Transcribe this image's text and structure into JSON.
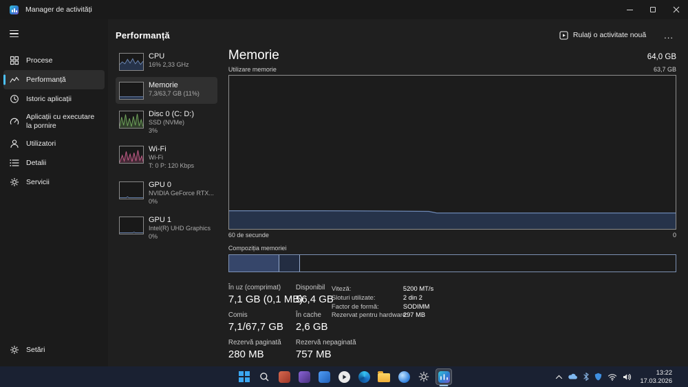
{
  "window": {
    "title": "Manager de activități"
  },
  "sidebar": {
    "items": [
      {
        "label": "Procese"
      },
      {
        "label": "Performanță"
      },
      {
        "label": "Istoric aplicații"
      },
      {
        "label": "Aplicații cu executare la pornire"
      },
      {
        "label": "Utilizatori"
      },
      {
        "label": "Detalii"
      },
      {
        "label": "Servicii"
      }
    ],
    "settings_label": "Setări"
  },
  "header": {
    "title": "Performanță",
    "run_new_task": "Rulați o activitate nouă",
    "more": "..."
  },
  "perf_list": [
    {
      "name": "CPU",
      "line1": "16% 2,33 GHz",
      "line2": ""
    },
    {
      "name": "Memorie",
      "line1": "7,3/63,7 GB (11%)",
      "line2": ""
    },
    {
      "name": "Disc 0 (C: D:)",
      "line1": "SSD (NVMe)",
      "line2": "3%"
    },
    {
      "name": "Wi-Fi",
      "line1": "Wi-Fi",
      "line2": "T: 0 P: 120 Kbps"
    },
    {
      "name": "GPU 0",
      "line1": "NVIDIA GeForce RTX...",
      "line2": "0%"
    },
    {
      "name": "GPU 1",
      "line1": "Intel(R) UHD Graphics",
      "line2": "0%"
    }
  ],
  "memory": {
    "title": "Memorie",
    "capacity": "64,0 GB",
    "chart_title": "Utilizare memorie",
    "chart_max": "63,7 GB",
    "x_left": "60 de secunde",
    "x_right": "0",
    "composition_title": "Compoziția memoriei",
    "usage_percent": 11,
    "usage_history_percent": [
      12,
      12,
      12,
      12,
      12,
      12,
      11,
      11,
      11,
      11,
      11,
      11
    ],
    "stats": [
      {
        "label": "În uz (comprimat)",
        "value": "7,1 GB (0,1 MB)"
      },
      {
        "label": "Disponibil",
        "value": "56,4 GB"
      },
      {
        "label": "Comis",
        "value": "7,1/67,7 GB"
      },
      {
        "label": "În cache",
        "value": "2,6 GB"
      },
      {
        "label": "Rezervă paginată",
        "value": "280 MB"
      },
      {
        "label": "Rezervă nepaginată",
        "value": "757 MB"
      }
    ],
    "details": [
      {
        "label": "Viteză:",
        "value": "5200 MT/s"
      },
      {
        "label": "Sloturi utilizate:",
        "value": "2 din 2"
      },
      {
        "label": "Factor de formă:",
        "value": "SODIMM"
      },
      {
        "label": "Rezervat pentru hardware:",
        "value": "297 MB"
      }
    ]
  },
  "taskbar": {
    "time": "13:22",
    "date": "17.03.2026"
  },
  "colors": {
    "accent": "#4cc2ff",
    "memory_line": "#6d88b5",
    "memory_fill": "#26334a",
    "disk_green": "#71a65c",
    "wifi_pink": "#c75d8a"
  }
}
